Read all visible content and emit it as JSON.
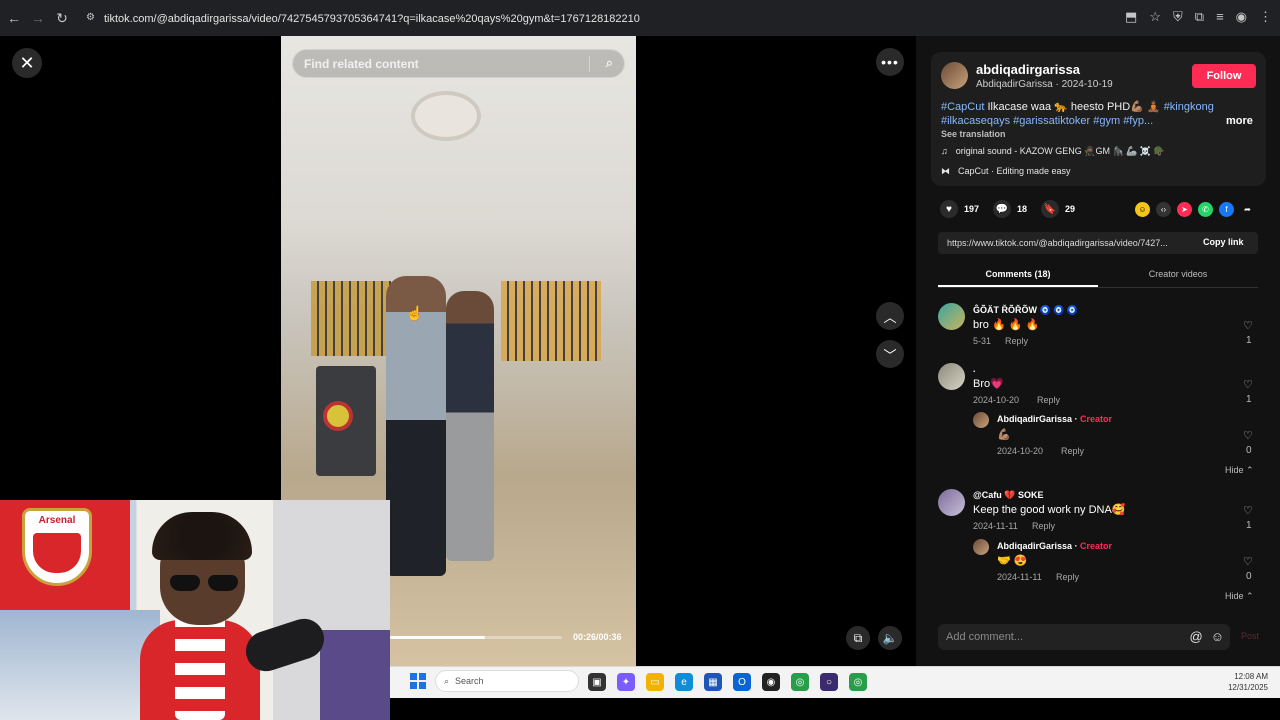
{
  "browser": {
    "url": "tiktok.com/@abdiqadirgarissa/video/7427545793705364741?q=ilkacase%20qays%20gym&t=1767128182210",
    "nav_back": "←",
    "nav_forward": "→",
    "nav_reload": "↻"
  },
  "video": {
    "search_placeholder": "Find related content",
    "current_time": "00:26/00:36",
    "progress_fraction": 0.55
  },
  "webcam": {
    "flag_text": "Arsenal"
  },
  "post": {
    "username": "abdiqadirgarissa",
    "display_line": "AbdiqadirGarissa · 2024-10-19",
    "follow_label": "Follow",
    "caption_tag_1": "#CapCut",
    "caption_text": " Ilkacase waa 🐆 heesto PHD💪🏽 🧘🏾 ",
    "caption_tag_2": "#kingkong",
    "caption_tags_line2": "#ilkacaseqays #garissatiktoker #gym #fyp...",
    "more_label": "more",
    "see_translation": "See translation",
    "music": "original sound - KAZOW GENG 🥷🏾GM 🦍 🦾 ☠️ 🪖",
    "capcut": "CapCut · Editing made easy",
    "likes": "197",
    "comments": "18",
    "saves": "29",
    "link": "https://www.tiktok.com/@abdiqadirgarissa/video/7427...",
    "copy_link_label": "Copy link"
  },
  "tabs": {
    "comments": "Comments (18)",
    "creator_videos": "Creator videos"
  },
  "comments": [
    {
      "name": "ĜÕÄT ŘÕŘÕW 🧿 🧿 🧿",
      "text": "bro 🔥 🔥 🔥",
      "date": "5-31",
      "reply": "Reply",
      "likes": "1"
    },
    {
      "name": ".",
      "text": "Bro💗",
      "date": "2024-10-20",
      "reply": "Reply",
      "likes": "1",
      "replies": [
        {
          "name": "AbdiqadirGarissa · ",
          "creator": "Creator",
          "text": "💪🏽",
          "date": "2024-10-20",
          "reply": "Reply",
          "likes": "0"
        }
      ],
      "hide": "Hide ⌃"
    },
    {
      "name": "@Cafu 💔 SOKE",
      "text": "Keep the good work ny DNA🥰",
      "date": "2024-11-11",
      "reply": "Reply",
      "likes": "1",
      "replies": [
        {
          "name": "AbdiqadirGarissa · ",
          "creator": "Creator",
          "text": "🤝 😍",
          "date": "2024-11-11",
          "reply": "Reply",
          "likes": "0"
        }
      ],
      "hide": "Hide ⌃"
    }
  ],
  "add_comment": {
    "placeholder": "Add comment...",
    "post_label": "Post"
  },
  "taskbar": {
    "search_label": "Search",
    "time": "12:08 AM",
    "date": "12/31/2025"
  },
  "colors": {
    "accent": "#fe2c55",
    "tag": "#86b7ff",
    "panel_bg": "#121212"
  }
}
